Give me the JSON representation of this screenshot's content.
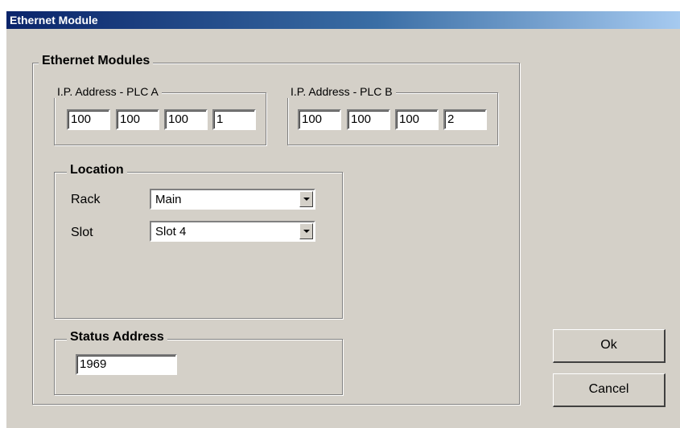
{
  "window": {
    "title": "Ethernet Module"
  },
  "ethernet_modules": {
    "label": "Ethernet Modules",
    "plc_a": {
      "label": "I.P. Address - PLC A",
      "octets": [
        "100",
        "100",
        "100",
        "1"
      ]
    },
    "plc_b": {
      "label": "I.P. Address - PLC B",
      "octets": [
        "100",
        "100",
        "100",
        "2"
      ]
    }
  },
  "location": {
    "label": "Location",
    "rack_label": "Rack",
    "rack_value": "Main",
    "slot_label": "Slot",
    "slot_value": "Slot 4"
  },
  "status": {
    "label": "Status Address",
    "value": "1969"
  },
  "buttons": {
    "ok_label": "Ok",
    "cancel_label": "Cancel"
  }
}
